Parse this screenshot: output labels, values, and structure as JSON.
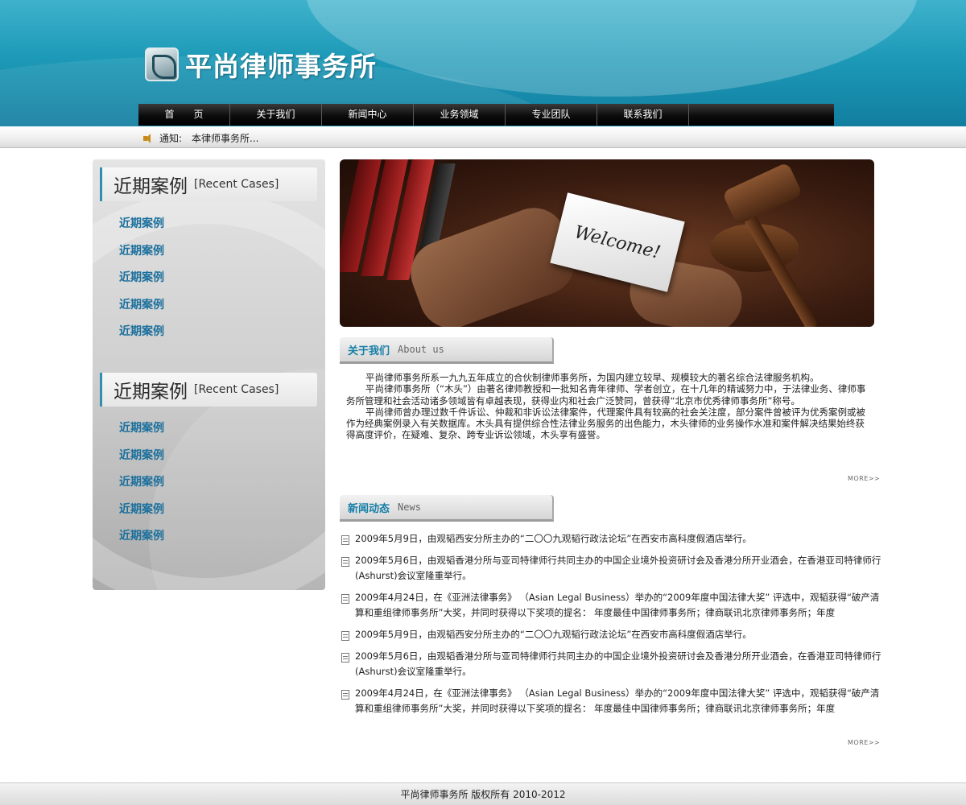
{
  "header": {
    "site_title": "平尚律师事务所",
    "nav": [
      "首　　页",
      "关于我们",
      "新闻中心",
      "业务领域",
      "专业团队",
      "联系我们"
    ]
  },
  "notice": {
    "label": "通知:",
    "text": "本律师事务所..."
  },
  "sidebar": {
    "sections": [
      {
        "title_cn": "近期案例",
        "title_en": "[Recent Cases]",
        "items": [
          "近期案例",
          "近期案例",
          "近期案例",
          "近期案例",
          "近期案例"
        ]
      },
      {
        "title_cn": "近期案例",
        "title_en": "[Recent Cases]",
        "items": [
          "近期案例",
          "近期案例",
          "近期案例",
          "近期案例",
          "近期案例"
        ]
      }
    ]
  },
  "banner": {
    "card_text": "Welcome!"
  },
  "about": {
    "title_cn": "关于我们",
    "title_en": "About us",
    "paragraphs": [
      "平尚律师事务所系一九九五年成立的合伙制律师事务所，为国内建立较早、规模较大的著名综合法律服务机构。",
      "平尚律师事务所（“木头”）由著名律师教授和一批知名青年律师、学者创立，在十几年的精诚努力中，于法律业务、律师事务所管理和社会活动诸多领域皆有卓越表现，获得业内和社会广泛赞同，曾获得“北京市优秀律师事务所”称号。",
      "平尚律师曾办理过数千件诉讼、仲裁和非诉讼法律案件，代理案件具有较高的社会关注度，部分案件曾被评为优秀案例或被作为经典案例录入有关数据库。木头具有提供综合性法律业务服务的出色能力，木头律师的业务操作水准和案件解决结果始终获得高度评价，在疑难、复杂、跨专业诉讼领域，木头享有盛誉。"
    ],
    "more": "MORE>>"
  },
  "news": {
    "title_cn": "新闻动态",
    "title_en": "News",
    "items": [
      "2009年5月9日，由观韬西安分所主办的“二〇〇九观韬行政法论坛”在西安市高科度假酒店举行。",
      "2009年5月6日，由观韬香港分所与亚司特律师行共同主办的中国企业境外投资研讨会及香港分所开业酒会，在香港亚司特律师行(Ashurst)会议室隆重举行。",
      "2009年4月24日，在《亚洲法律事务》 （Asian Legal Business）举办的“2009年度中国法律大奖” 评选中，观韬获得“破产清算和重组律师事务所”大奖，并同时获得以下奖项的提名： 年度最佳中国律师事务所；律商联讯北京律师事务所；年度",
      "2009年5月9日，由观韬西安分所主办的“二〇〇九观韬行政法论坛”在西安市高科度假酒店举行。",
      "2009年5月6日，由观韬香港分所与亚司特律师行共同主办的中国企业境外投资研讨会及香港分所开业酒会，在香港亚司特律师行(Ashurst)会议室隆重举行。",
      "2009年4月24日，在《亚洲法律事务》 （Asian Legal Business）举办的“2009年度中国法律大奖” 评选中，观韬获得“破产清算和重组律师事务所”大奖，并同时获得以下奖项的提名： 年度最佳中国律师事务所；律商联讯北京律师事务所；年度"
    ],
    "more": "MORE>>"
  },
  "footer": {
    "text": "平尚律师事务所 版权所有 2010-2012"
  },
  "icons": {
    "notice": "speaker-icon",
    "news_item": "document-icon",
    "logo": "logo-mark-icon"
  }
}
